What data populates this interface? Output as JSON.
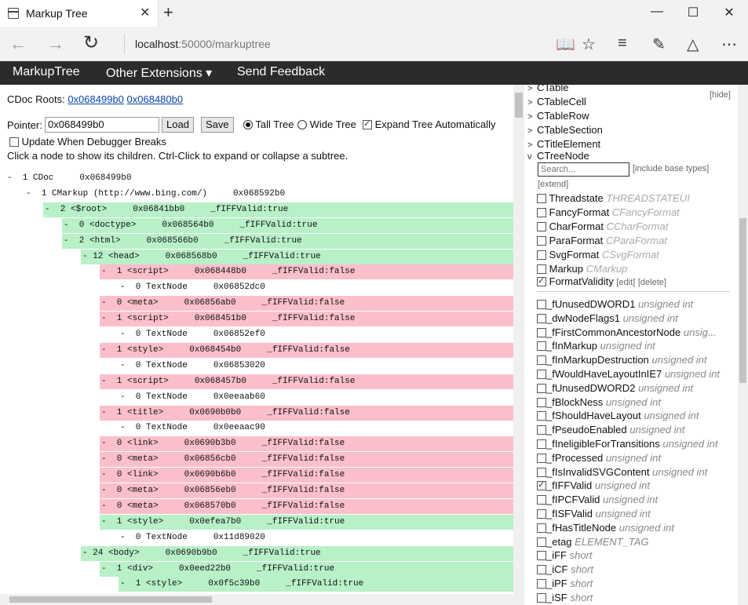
{
  "browser": {
    "tab_title": "Markup Tree",
    "url_host": "localhost",
    "url_rest": ":50000/markuptree"
  },
  "menu": {
    "items": [
      "MarkupTree",
      "Other Extensions ▾",
      "Send Feedback"
    ]
  },
  "controls": {
    "roots_label": "CDoc Roots:",
    "roots": [
      "0x068499b0",
      "0x068480b0"
    ],
    "pointer_label": "Pointer:",
    "pointer_value": "0x068499b0",
    "load_label": "Load",
    "save_label": "Save",
    "tall_tree_label": "Tall Tree",
    "wide_tree_label": "Wide Tree",
    "expand_label": "Expand Tree Automatically",
    "update_label": "Update When Debugger Breaks",
    "hint": "Click a node to show its children. Ctrl-Click to expand or collapse a subtree."
  },
  "tree": [
    {
      "text": "-  1 CDoc     0x068499b0",
      "indent": 0,
      "status": "none"
    },
    {
      "text": "-  1 CMarkup (http://www.bing.com/)     0x068592b0",
      "indent": 1,
      "status": "none"
    },
    {
      "text": "-  2 <$root>     0x06841bb0     _fIFFValid:true",
      "indent": 2,
      "status": "green"
    },
    {
      "text": "-  0 <doctype>     0x068564b0     _fIFFValid:true",
      "indent": 3,
      "status": "green"
    },
    {
      "text": "-  2 <html>     0x068566b0     _fIFFValid:true",
      "indent": 3,
      "status": "green"
    },
    {
      "text": "- 12 <head>     0x068568b0     _fIFFValid:true",
      "indent": 4,
      "status": "green"
    },
    {
      "text": "-  1 <script>     0x068448b0     _fIFFValid:false",
      "indent": 5,
      "status": "pink"
    },
    {
      "text": "-  0 TextNode     0x06852dc0",
      "indent": 6,
      "status": "none"
    },
    {
      "text": "-  0 <meta>     0x06856ab0     _fIFFValid:false",
      "indent": 5,
      "status": "pink"
    },
    {
      "text": "-  1 <script>     0x068451b0     _fIFFValid:false",
      "indent": 5,
      "status": "pink"
    },
    {
      "text": "-  0 TextNode     0x06852ef0",
      "indent": 6,
      "status": "none"
    },
    {
      "text": "-  1 <style>     0x068454b0     _fIFFValid:false",
      "indent": 5,
      "status": "pink"
    },
    {
      "text": "-  0 TextNode     0x06853020",
      "indent": 6,
      "status": "none"
    },
    {
      "text": "-  1 <script>     0x068457b0     _fIFFValid:false",
      "indent": 5,
      "status": "pink"
    },
    {
      "text": "-  0 TextNode     0x0eeaab60",
      "indent": 6,
      "status": "none"
    },
    {
      "text": "-  1 <title>     0x0690b0b0     _fIFFValid:false",
      "indent": 5,
      "status": "pink"
    },
    {
      "text": "-  0 TextNode     0x0eeaac90",
      "indent": 6,
      "status": "none"
    },
    {
      "text": "-  0 <link>     0x0690b3b0     _fIFFValid:false",
      "indent": 5,
      "status": "pink"
    },
    {
      "text": "-  0 <meta>     0x06856cb0     _fIFFValid:false",
      "indent": 5,
      "status": "pink"
    },
    {
      "text": "-  0 <link>     0x0690b6b0     _fIFFValid:false",
      "indent": 5,
      "status": "pink"
    },
    {
      "text": "-  0 <meta>     0x06856eb0     _fIFFValid:false",
      "indent": 5,
      "status": "pink"
    },
    {
      "text": "-  0 <meta>     0x068570b0     _fIFFValid:false",
      "indent": 5,
      "status": "pink"
    },
    {
      "text": "-  1 <style>     0x0efea7b0     _fIFFValid:true",
      "indent": 5,
      "status": "green"
    },
    {
      "text": "-  0 TextNode     0x11d89020",
      "indent": 6,
      "status": "none"
    },
    {
      "text": "- 24 <body>     0x0690b9b0     _fIFFValid:true",
      "indent": 4,
      "status": "green"
    },
    {
      "text": "-  1 <div>     0x0eed22b0     _fIFFValid:true",
      "indent": 5,
      "status": "green"
    },
    {
      "text": "-  1 <style>     0x0f5c39b0     _fIFFValid:true",
      "indent": 6,
      "status": "green"
    }
  ],
  "right": {
    "hide_label": "[hide]",
    "classes": [
      "CTable",
      "CTableCell",
      "CTableRow",
      "CTableSection",
      "CTitleElement"
    ],
    "open_class": "CTreeNode",
    "search_placeholder": "Search...",
    "include_base": "[include base types]",
    "extend": "[extend]",
    "formats": [
      {
        "name": "Threadstate",
        "type": "THREADSTATEUI",
        "checked": false
      },
      {
        "name": "FancyFormat",
        "type": "CFancyFormat",
        "checked": false
      },
      {
        "name": "CharFormat",
        "type": "CCharFormat",
        "checked": false
      },
      {
        "name": "ParaFormat",
        "type": "CParaFormat",
        "checked": false
      },
      {
        "name": "SvgFormat",
        "type": "CSvgFormat",
        "checked": false
      },
      {
        "name": "Markup",
        "type": "CMarkup",
        "checked": false
      }
    ],
    "format_validity": {
      "name": "FormatValidity",
      "edit": "[edit]",
      "delete": "[delete]"
    },
    "fields": [
      {
        "name": "_fUnusedDWORD1",
        "type": "unsigned int",
        "checked": false
      },
      {
        "name": "_dwNodeFlags1",
        "type": "unsigned int",
        "checked": false
      },
      {
        "name": "_fFirstCommonAncestorNode",
        "type": "unsig...",
        "checked": false
      },
      {
        "name": "_fInMarkup",
        "type": "unsigned int",
        "checked": false
      },
      {
        "name": "_fInMarkupDestruction",
        "type": "unsigned int",
        "checked": false
      },
      {
        "name": "_fWouldHaveLayoutInIE7",
        "type": "unsigned int",
        "checked": false
      },
      {
        "name": "_fUnusedDWORD2",
        "type": "unsigned int",
        "checked": false
      },
      {
        "name": "_fBlockNess",
        "type": "unsigned int",
        "checked": false
      },
      {
        "name": "_fShouldHaveLayout",
        "type": "unsigned int",
        "checked": false
      },
      {
        "name": "_fPseudoEnabled",
        "type": "unsigned int",
        "checked": false
      },
      {
        "name": "_fIneligibleForTransitions",
        "type": "unsigned int",
        "checked": false
      },
      {
        "name": "_fProcessed",
        "type": "unsigned int",
        "checked": false
      },
      {
        "name": "_fIsInvalidSVGContent",
        "type": "unsigned int",
        "checked": false
      },
      {
        "name": "_fIFFValid",
        "type": "unsigned int",
        "checked": true
      },
      {
        "name": "_fIPCFValid",
        "type": "unsigned int",
        "checked": false
      },
      {
        "name": "_fISFValid",
        "type": "unsigned int",
        "checked": false
      },
      {
        "name": "_fHasTitleNode",
        "type": "unsigned int",
        "checked": false
      },
      {
        "name": "_etag",
        "type": "ELEMENT_TAG",
        "checked": false
      },
      {
        "name": "_iFF",
        "type": "short",
        "checked": false
      },
      {
        "name": "_iCF",
        "type": "short",
        "checked": false
      },
      {
        "name": "_iPF",
        "type": "short",
        "checked": false
      },
      {
        "name": "_iSF",
        "type": "short",
        "checked": false
      }
    ]
  }
}
